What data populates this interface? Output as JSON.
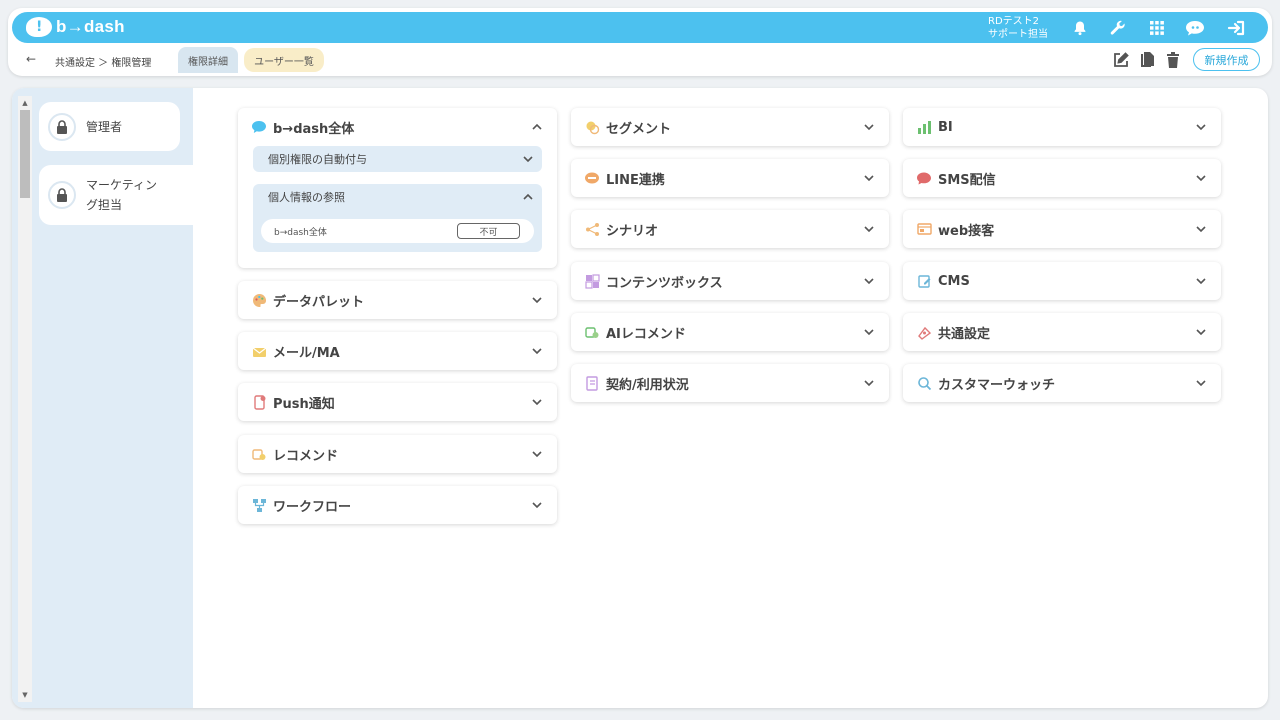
{
  "app": {
    "logo_text": "b→dash",
    "user_line1": "RDテスト2",
    "user_line2": "サポート担当"
  },
  "header": {
    "breadcrumb": "共通設定 ＞ 権限管理",
    "tabs": [
      "権限詳細",
      "ユーザー一覧"
    ],
    "new_button": "新規作成"
  },
  "roles": [
    {
      "label": "管理者"
    },
    {
      "label": "マーケティン\nグ担当"
    }
  ],
  "panels": {
    "bdash": {
      "title": "b→dash全体",
      "sub1": "個別権限の自動付与",
      "sub2": "個人情報の参照",
      "row_label": "b→dash全体",
      "row_value": "不可"
    },
    "col1": [
      "データパレット",
      "メール/MA",
      "Push通知",
      "レコメンド",
      "ワークフロー"
    ],
    "col2": [
      "セグメント",
      "LINE連携",
      "シナリオ",
      "コンテンツボックス",
      "AIレコメンド",
      "契約/利用状況"
    ],
    "col3": [
      "BI",
      "SMS配信",
      "web接客",
      "CMS",
      "共通設定",
      "カスタマーウォッチ"
    ]
  },
  "colors": {
    "accent": "#4cc1ef",
    "panel_bg": "#e0ecf6",
    "tab_yellow": "#f9edc8"
  }
}
